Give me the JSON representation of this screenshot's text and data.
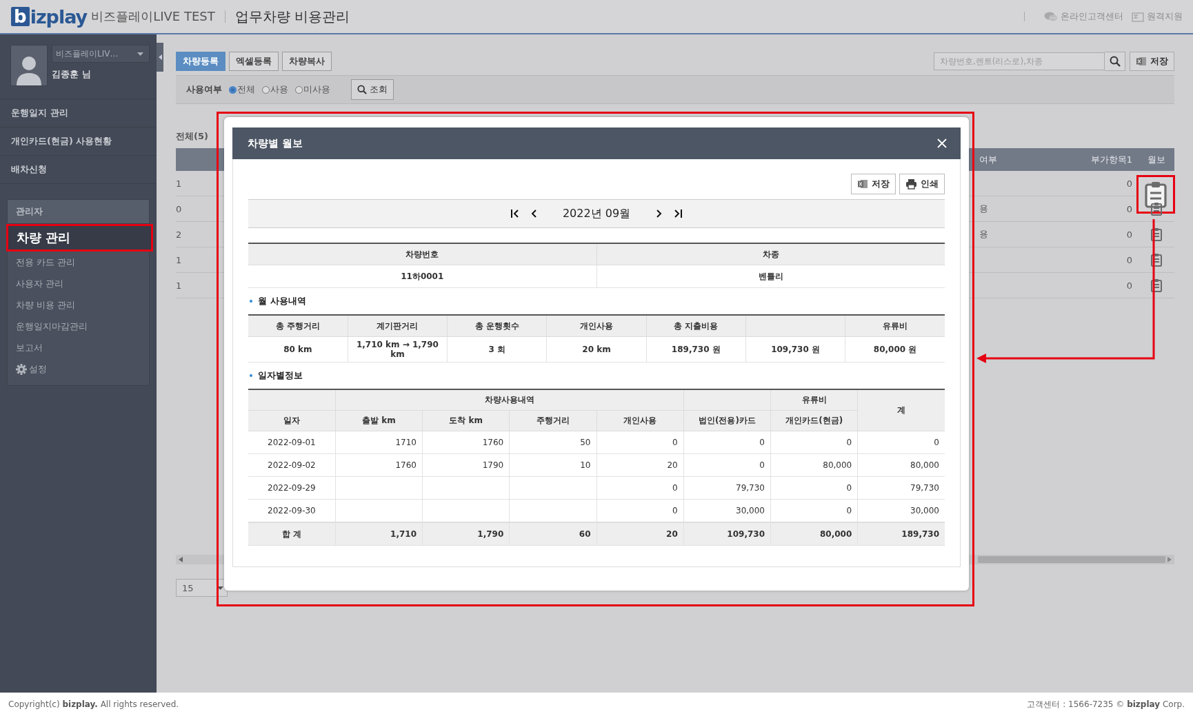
{
  "header": {
    "logo_mark": "b",
    "logo_text": "izplay",
    "site": "비즈플레이LIVE TEST",
    "title": "업무차량 비용관리",
    "links": [
      {
        "kind": "chat",
        "label": "온라인고객센터"
      },
      {
        "kind": "remote",
        "label": "원격지원"
      }
    ]
  },
  "sidebar": {
    "company": "비즈플레이LIV…",
    "user": "김종훈 님",
    "menu": [
      "운행일지 관리",
      "개인카드(현금) 사용현황",
      "배차신청"
    ],
    "admin": {
      "title": "관리자",
      "items": [
        {
          "kind": "link",
          "label": "차량 관리",
          "selected": true,
          "highlighted": true
        },
        {
          "kind": "link",
          "label": "전용 카드 관리",
          "selected": false,
          "highlighted": false
        },
        {
          "kind": "link",
          "label": "사용자 관리",
          "selected": false,
          "highlighted": false
        },
        {
          "kind": "link",
          "label": "차량 비용 관리",
          "selected": false,
          "highlighted": false
        },
        {
          "kind": "link",
          "label": "운행일지마감관리",
          "selected": false,
          "highlighted": false
        },
        {
          "kind": "link",
          "label": "보고서",
          "selected": false,
          "highlighted": false
        },
        {
          "kind": "settings",
          "label": "설정",
          "selected": false,
          "highlighted": false
        }
      ]
    }
  },
  "toolbar": {
    "buttons": [
      {
        "label": "차량등록",
        "primary": true
      },
      {
        "label": "엑셀등록",
        "primary": false
      },
      {
        "label": "차량복사",
        "primary": false
      }
    ],
    "search": {
      "placeholder": "차량번호,렌트(리스로),차종"
    },
    "save": "저장"
  },
  "filter": {
    "label": "사용여부",
    "options": [
      {
        "label": "전체",
        "selected": true
      },
      {
        "label": "사용",
        "selected": false
      },
      {
        "label": "미사용",
        "selected": false
      }
    ],
    "search_button": "조회"
  },
  "list": {
    "total": "전체(5)",
    "columns": [
      "여부",
      "부가항목1",
      "월보"
    ],
    "rows": [
      {
        "no": "1",
        "extra": "0",
        "highlighted": true
      },
      {
        "no": "0",
        "status": "용",
        "extra": "0",
        "highlighted": false
      },
      {
        "no": "2",
        "status": "용",
        "extra": "0",
        "highlighted": false
      },
      {
        "no": "1",
        "extra": "0",
        "highlighted": false
      },
      {
        "no": "1",
        "extra": "0",
        "highlighted": false
      }
    ]
  },
  "page_size": "15",
  "modal": {
    "title": "차량별 월보",
    "highlighted": true,
    "buttons": [
      {
        "kind": "excel",
        "label": "저장"
      },
      {
        "kind": "print",
        "label": "인쇄"
      }
    ],
    "month": "2022년 09월",
    "vehicle": {
      "columns": [
        "차량번호",
        "차종"
      ],
      "values": [
        "11하0001",
        "벤틀리"
      ]
    },
    "monthly": {
      "title": "월 사용내역",
      "columns": [
        {
          "label": "총 주행거리"
        },
        {
          "label": "계기판거리"
        },
        {
          "label": "총 운행횟수"
        },
        {
          "label": "개인사용"
        },
        {
          "label": "총 지출비용"
        },
        {},
        {
          "label": "유류비"
        }
      ],
      "values": [
        "80 km",
        "1,710 km → 1,790 km",
        "3 회",
        "20 km",
        "189,730 원",
        "109,730 원",
        "80,000 원"
      ]
    },
    "daily": {
      "title": "일자별정보",
      "groups": [
        {
          "columns": [
            "일자"
          ]
        },
        {
          "label": "차량사용내역",
          "columns": [
            "출발 km",
            "도착 km",
            "주행거리",
            "개인사용"
          ]
        },
        {
          "columns": [
            "법인(전용)카드"
          ]
        },
        {
          "label": "유류비",
          "columns": [
            "개인카드(현금)"
          ]
        }
      ],
      "total_column": "계",
      "rows": [
        [
          "2022-09-01",
          "1710",
          "1760",
          "50",
          "0",
          "0",
          "0",
          "0"
        ],
        [
          "2022-09-02",
          "1760",
          "1790",
          "10",
          "20",
          "0",
          "80,000",
          "80,000"
        ],
        [
          "2022-09-29",
          null,
          null,
          null,
          "0",
          "79,730",
          "0",
          "79,730"
        ],
        [
          "2022-09-30",
          null,
          null,
          null,
          "0",
          "30,000",
          "0",
          "30,000"
        ]
      ],
      "total": [
        "합 계",
        "1,710",
        "1,790",
        "60",
        "20",
        "109,730",
        "80,000",
        "189,730"
      ]
    }
  },
  "footer": {
    "left": "Copyright(c) **bizplay.** All rights reserved.",
    "right": "고객센터 : 1566-7235 © **bizplay** Corp."
  }
}
